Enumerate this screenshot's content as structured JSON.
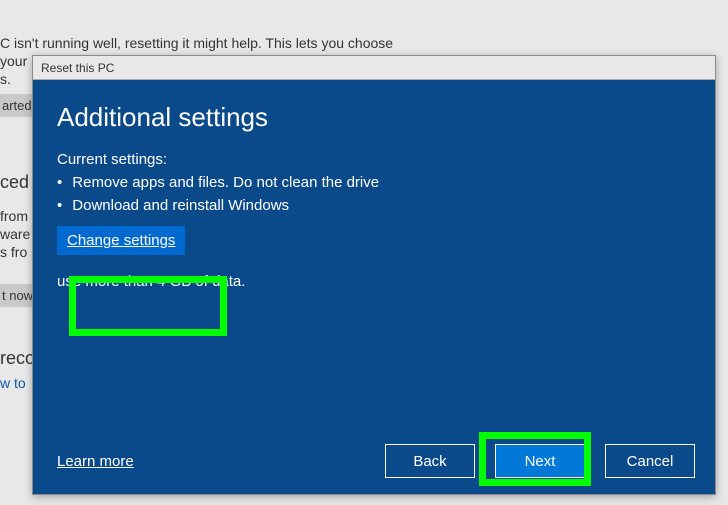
{
  "background": {
    "line1": "C isn't running well, resetting it might help. This lets you choose",
    "line2": "your",
    "line3": "s.",
    "started_btn": "arted",
    "now_btn": "t now",
    "heading1": "ced",
    "heading2": "reco",
    "frag1": "from",
    "frag2": "ware",
    "frag3": "s fro",
    "link_wto": "w to"
  },
  "dialog": {
    "titlebar": "Reset this PC",
    "title": "Additional settings",
    "current_label": "Current settings:",
    "bullets": [
      "Remove apps and files. Do not clean the drive",
      "Download and reinstall Windows"
    ],
    "change_link": "Change settings",
    "cloud_note_suffix": "use more than 4 GB of data.",
    "learn_more": "Learn more",
    "buttons": {
      "back": "Back",
      "next": "Next",
      "cancel": "Cancel"
    }
  }
}
